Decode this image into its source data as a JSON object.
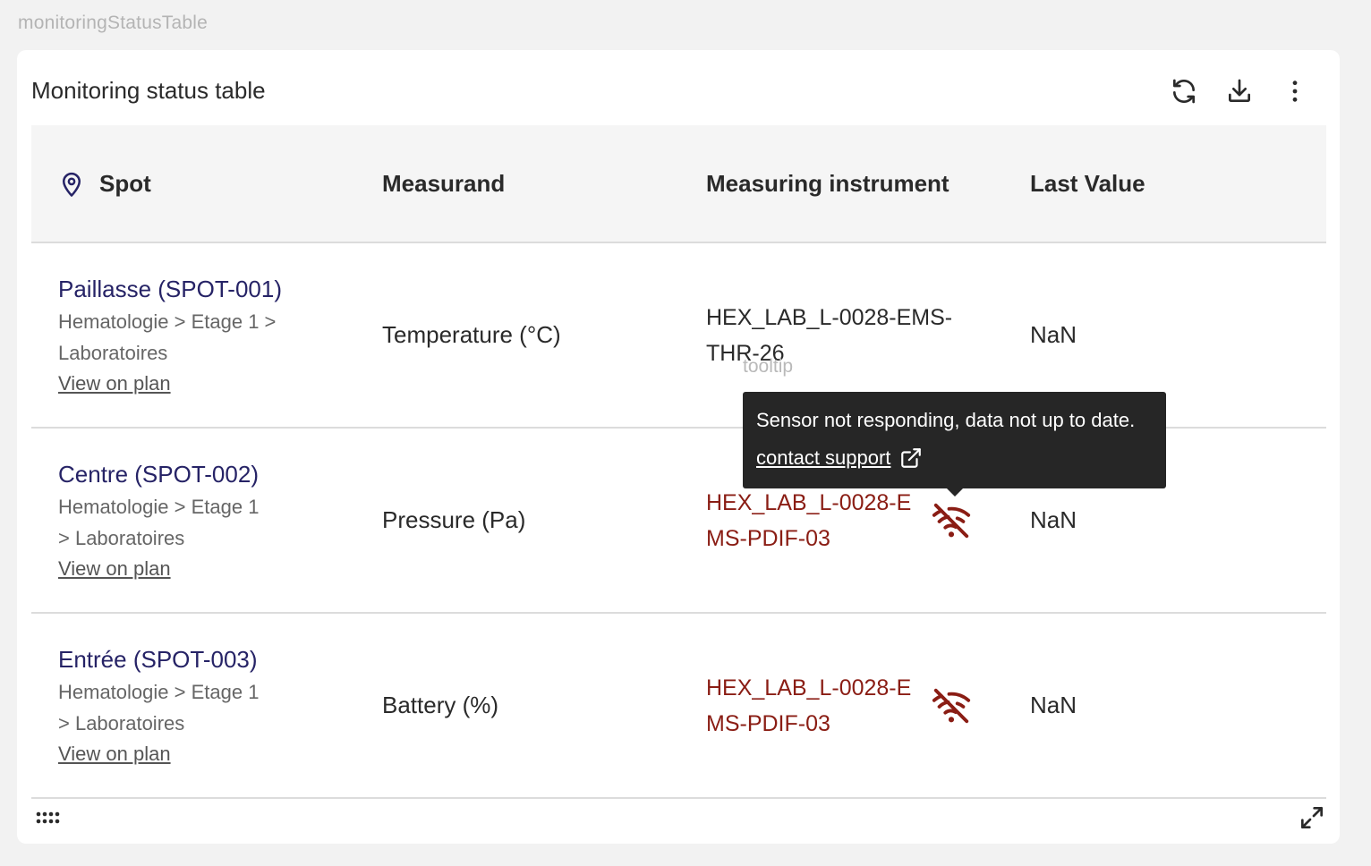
{
  "page": {
    "label": "monitoringStatusTable"
  },
  "card": {
    "title": "Monitoring status table",
    "toolbar": {
      "refresh_icon": "refresh-icon",
      "download_icon": "download-icon",
      "more_icon": "more-vertical-icon"
    }
  },
  "table": {
    "headers": {
      "spot": "Spot",
      "measurand": "Measurand",
      "instrument": "Measuring instrument",
      "last_value": "Last Value"
    },
    "rows": [
      {
        "spot_name": "Paillasse (SPOT-001)",
        "spot_path": "Hematologie > Etage 1 > Laboratoires",
        "view_link": "View on plan",
        "measurand": "Temperature (°C)",
        "instrument": "HEX_LAB_L-0028-EMS-THR-26",
        "instrument_status": "ok",
        "last_value": "NaN"
      },
      {
        "spot_name": "Centre (SPOT-002)",
        "spot_path": "Hematologie > Etage 1 > Laboratoires",
        "view_link": "View on plan",
        "measurand": "Pressure (Pa)",
        "instrument": "HEX_LAB_L-0028-EMS-PDIF-03",
        "instrument_status": "not-responding",
        "last_value": "NaN"
      },
      {
        "spot_name": "Entrée (SPOT-003)",
        "spot_path": "Hematologie > Etage 1 > Laboratoires",
        "view_link": "View on plan",
        "measurand": "Battery (%)",
        "instrument": "HEX_LAB_L-0028-EMS-PDIF-03",
        "instrument_status": "not-responding",
        "last_value": "NaN"
      }
    ]
  },
  "tooltip": {
    "label": "tooltip",
    "message": "Sensor not responding, data not up to date.",
    "link": "contact support"
  },
  "colors": {
    "spot_name": "#262366",
    "error": "#8a1d14",
    "tooltip_bg": "#262626"
  }
}
